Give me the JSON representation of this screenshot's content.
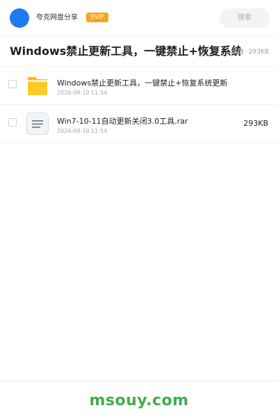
{
  "header": {
    "user_name": "夸克网盘分享",
    "badge": "SVIP",
    "search_placeholder": "搜索"
  },
  "share": {
    "title": "Windows禁止更新工具，一键禁止+恢复系统更新",
    "meta_prefix": "网盘",
    "meta_sep": "·",
    "total_size": "293KB"
  },
  "files": [
    {
      "type": "folder",
      "icon": "folder-icon",
      "name": "Windows禁止更新工具，一键禁止+恢复系统更新",
      "date": "2026-09-10 11:54",
      "size": ""
    },
    {
      "type": "file",
      "icon": "archive-file-icon",
      "name": "Win7-10-11自动更新关闭3.0工具.rar",
      "date": "2026-09-10 11:54",
      "size": "293KB"
    }
  ],
  "footer": {
    "watermark": "msouy.com"
  },
  "colors": {
    "avatar": "#1f7af0",
    "badge": "#f5a623",
    "folder": "#ffc21a",
    "watermark": "#3fae4a"
  }
}
